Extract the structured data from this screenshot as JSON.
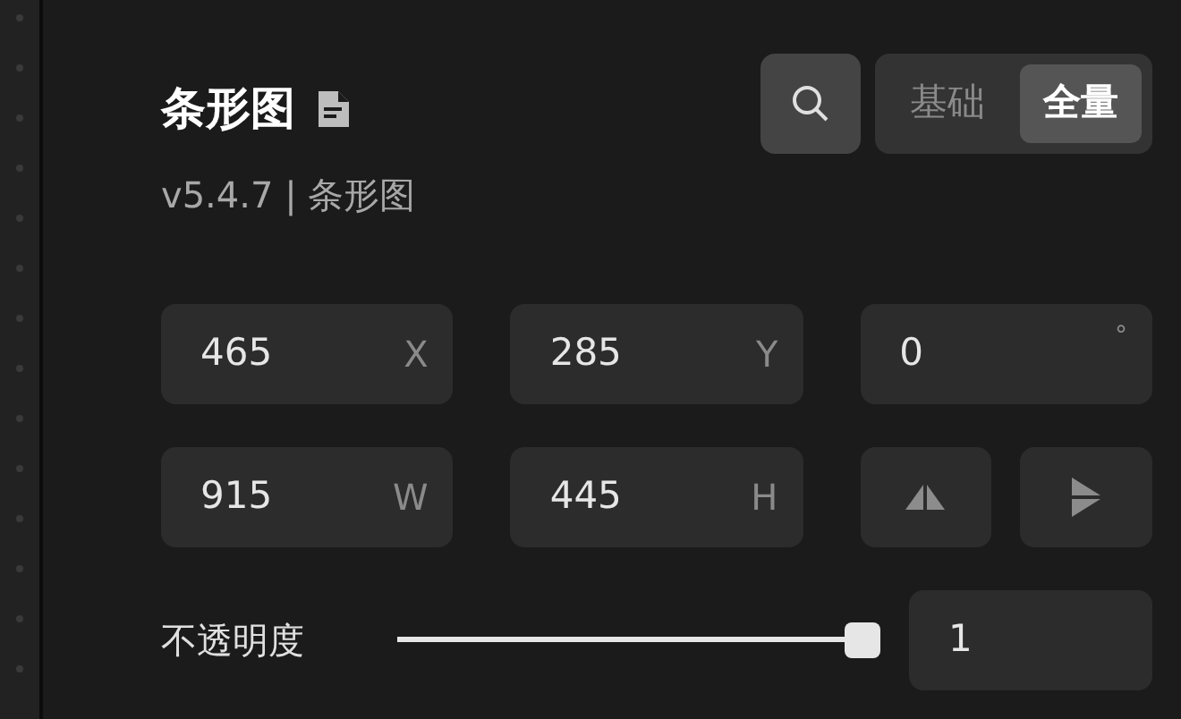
{
  "header": {
    "title": "条形图",
    "subtitle": "v5.4.7 | 条形图"
  },
  "mode_tabs": [
    {
      "label": "基础",
      "selected": false
    },
    {
      "label": "全量",
      "selected": true
    }
  ],
  "fields": [
    {
      "value": "465",
      "unit": "X"
    },
    {
      "value": "285",
      "unit": "Y"
    },
    {
      "value": "0",
      "unit": "°"
    },
    {
      "value": "915",
      "unit": "W"
    },
    {
      "value": "445",
      "unit": "H"
    }
  ],
  "opacity": {
    "label": "不透明度",
    "level": 1,
    "value": "1"
  }
}
